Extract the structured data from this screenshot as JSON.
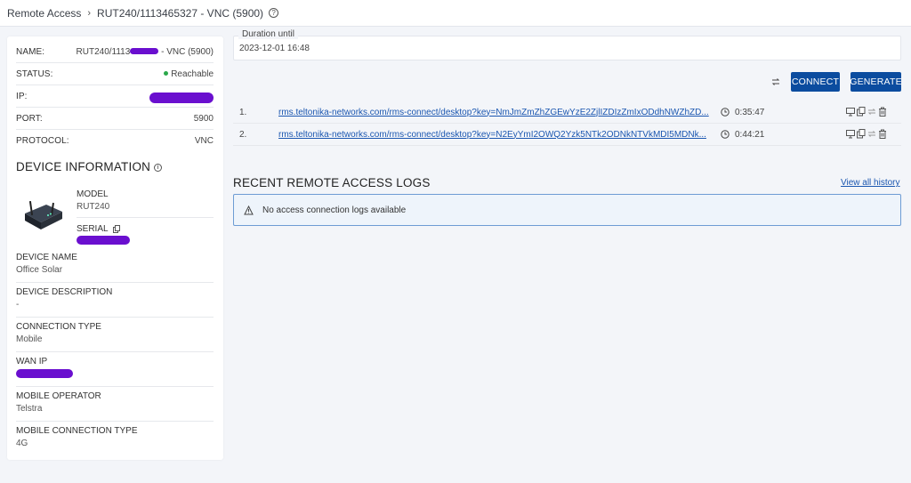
{
  "breadcrumb": {
    "root": "Remote Access",
    "separator": "›",
    "current": "RUT240/1113465327 - VNC (5900)",
    "help": "?"
  },
  "device": {
    "name_label": "NAME:",
    "name_prefix": "RUT240/1113",
    "name_suffix": " - VNC (5900)",
    "status_label": "STATUS:",
    "status_value": "Reachable",
    "ip_label": "IP:",
    "port_label": "PORT:",
    "port_value": "5900",
    "protocol_label": "PROTOCOL:",
    "protocol_value": "VNC"
  },
  "device_info": {
    "title": "DEVICE INFORMATION",
    "info": "i",
    "model_label": "MODEL",
    "model_value": "RUT240",
    "serial_label": "SERIAL",
    "device_name_label": "DEVICE NAME",
    "device_name_value": "Office Solar",
    "description_label": "DEVICE DESCRIPTION",
    "description_value": "-",
    "connection_type_label": "CONNECTION TYPE",
    "connection_type_value": "Mobile",
    "wan_ip_label": "WAN IP",
    "operator_label": "MOBILE OPERATOR",
    "operator_value": "Telstra",
    "mobile_conn_label": "MOBILE CONNECTION TYPE",
    "mobile_conn_value": "4G"
  },
  "duration": {
    "label": "Duration until",
    "value": "2023-12-01 16:48"
  },
  "actions": {
    "connect": "CONNECT",
    "generate": "GENERATE"
  },
  "sessions": [
    {
      "num": "1.",
      "link": "rms.teltonika-networks.com/rms-connect/desktop?key=NmJmZmZhZGEwYzE2ZjlIZDIzZmIxODdhNWZhZD...",
      "time": "0:35:47"
    },
    {
      "num": "2.",
      "link": "rms.teltonika-networks.com/rms-connect/desktop?key=N2EyYmI2OWQ2Yzk5NTk2ODNkNTVkMDI5MDNk...",
      "time": "0:44:21"
    }
  ],
  "logs": {
    "title": "RECENT REMOTE ACCESS LOGS",
    "view_all": "View all history",
    "empty": "No access connection logs available"
  },
  "colors": {
    "primary": "#0b4c9f",
    "link": "#1a56b0",
    "reachable": "#2ba84a",
    "redaction": "#6a0fcf"
  }
}
